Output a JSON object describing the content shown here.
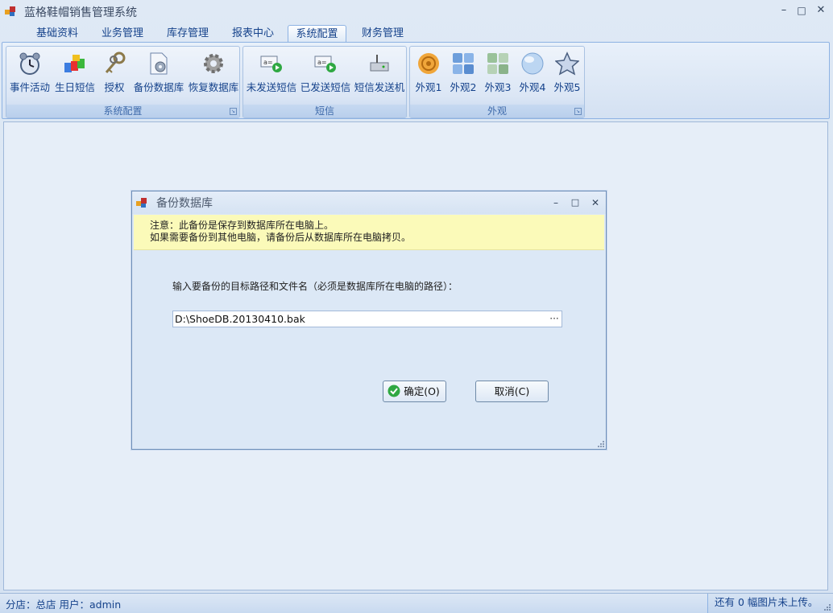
{
  "window": {
    "title": "蓝格鞋帽销售管理系统",
    "min": "–",
    "max": "□",
    "close": "✕"
  },
  "tabs": [
    "基础资料",
    "业务管理",
    "库存管理",
    "报表中心",
    "系统配置",
    "财务管理"
  ],
  "active_tab": "系统配置",
  "ribbon": {
    "groups": [
      {
        "label": "系统配置",
        "items": [
          "事件活动",
          "生日短信",
          "授权",
          "备份数据库",
          "恢复数据库"
        ]
      },
      {
        "label": "短信",
        "items": [
          "未发送短信",
          "已发送短信",
          "短信发送机"
        ]
      },
      {
        "label": "外观",
        "items": [
          "外观1",
          "外观2",
          "外观3",
          "外观4",
          "外观5"
        ]
      }
    ],
    "icons": [
      "alarm-clock-icon",
      "cubes-icon",
      "keys-icon",
      "backup-db-icon",
      "gear-icon",
      "unsent-sms-icon",
      "sent-sms-icon",
      "sms-modem-icon",
      "spiral-theme-icon",
      "blue-tiles-icon",
      "green-tiles-icon",
      "sphere-icon",
      "star-icon"
    ]
  },
  "dialog": {
    "title": "备份数据库",
    "note_line1": "注意：此备份是保存到数据库所在电脑上。",
    "note_line2": "如果需要备份到其他电脑，请备份后从数据库所在电脑拷贝。",
    "prompt": "输入要备份的目标路径和文件名（必须是数据库所在电脑的路径）：",
    "path_value": "D:\\ShoeDB.20130410.bak",
    "browse": "···",
    "ok_label": "确定(O)",
    "cancel_label": "取消(C)"
  },
  "status": {
    "left": "分店：总店  用户：admin",
    "right": "还有 0 幅图片未上传。"
  },
  "colors": {
    "accent": "#15428b",
    "note_bg": "#fbfab9",
    "frame": "#8db2e3"
  }
}
